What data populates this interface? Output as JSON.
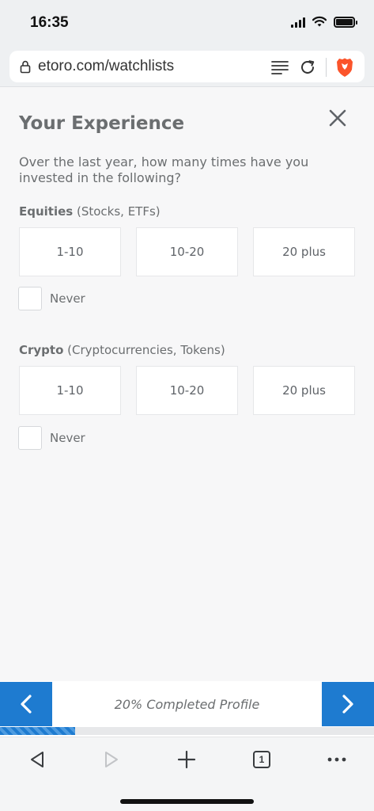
{
  "status": {
    "time": "16:35"
  },
  "browser": {
    "url": "etoro.com/watchlists",
    "tab_count": "1"
  },
  "form": {
    "title": "Your Experience",
    "question": "Over the last year, how many times have you invested in the following?",
    "sections": [
      {
        "label_bold": "Equities",
        "label_rest": " (Stocks, ETFs)",
        "options": [
          "1-10",
          "10-20",
          "20 plus"
        ],
        "never_label": "Never"
      },
      {
        "label_bold": "Crypto",
        "label_rest": " (Cryptocurrencies, Tokens)",
        "options": [
          "1-10",
          "10-20",
          "20 plus"
        ],
        "never_label": "Never"
      }
    ]
  },
  "progress": {
    "text": "20% Completed Profile",
    "fraction": 0.2
  },
  "colors": {
    "accent": "#1e7bd0",
    "brave": "#fb542b"
  }
}
